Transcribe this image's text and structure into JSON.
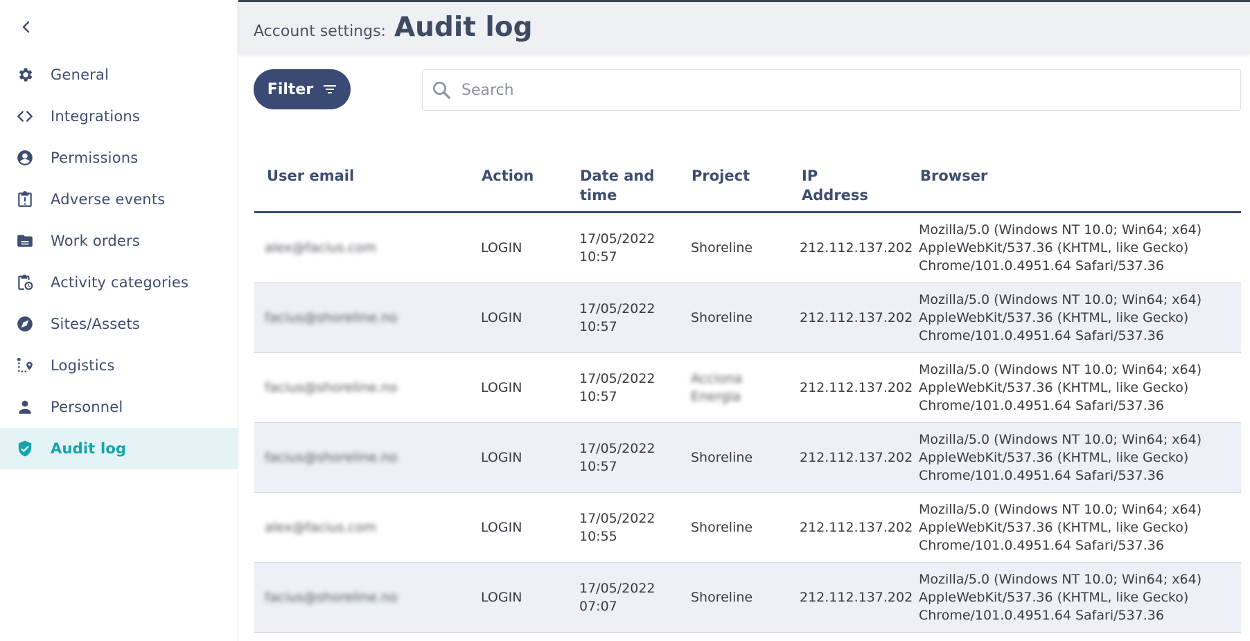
{
  "header": {
    "breadcrumb": "Account settings:",
    "title": "Audit log"
  },
  "sidebar": {
    "items": [
      {
        "label": "General",
        "icon": "gear-icon"
      },
      {
        "label": "Integrations",
        "icon": "code-icon"
      },
      {
        "label": "Permissions",
        "icon": "user-circle-icon"
      },
      {
        "label": "Adverse events",
        "icon": "clipboard-alert-icon"
      },
      {
        "label": "Work orders",
        "icon": "folder-icon"
      },
      {
        "label": "Activity categories",
        "icon": "clipboard-clock-icon"
      },
      {
        "label": "Sites/Assets",
        "icon": "compass-icon"
      },
      {
        "label": "Logistics",
        "icon": "route-pin-icon"
      },
      {
        "label": "Personnel",
        "icon": "person-icon"
      },
      {
        "label": "Audit log",
        "icon": "shield-check-icon",
        "active": true
      }
    ]
  },
  "toolbar": {
    "filter_label": "Filter",
    "search_placeholder": "Search"
  },
  "table": {
    "columns": [
      "User email",
      "Action",
      "Date and time",
      "Project",
      "IP Address",
      "Browser"
    ],
    "rows": [
      {
        "email": "alex@facius.com",
        "action": "LOGIN",
        "date": "17/05/2022",
        "time": "10:57",
        "project": "Shoreline",
        "ip": "212.112.137.202",
        "browser1": "Mozilla/5.0 (Windows NT 10.0; Win64; x64)",
        "browser2": "AppleWebKit/537.36 (KHTML, like Gecko)",
        "browser3": "Chrome/101.0.4951.64 Safari/537.36"
      },
      {
        "email": "facius@shoreline.no",
        "action": "LOGIN",
        "date": "17/05/2022",
        "time": "10:57",
        "project": "Shoreline",
        "ip": "212.112.137.202",
        "browser1": "Mozilla/5.0 (Windows NT 10.0; Win64; x64)",
        "browser2": "AppleWebKit/537.36 (KHTML, like Gecko)",
        "browser3": "Chrome/101.0.4951.64 Safari/537.36"
      },
      {
        "email": "facius@shoreline.no",
        "action": "LOGIN",
        "date": "17/05/2022",
        "time": "10:57",
        "project": "Acciona Energia",
        "ip": "212.112.137.202",
        "browser1": "Mozilla/5.0 (Windows NT 10.0; Win64; x64)",
        "browser2": "AppleWebKit/537.36 (KHTML, like Gecko)",
        "browser3": "Chrome/101.0.4951.64 Safari/537.36"
      },
      {
        "email": "facius@shoreline.no",
        "action": "LOGIN",
        "date": "17/05/2022",
        "time": "10:57",
        "project": "Shoreline",
        "ip": "212.112.137.202",
        "browser1": "Mozilla/5.0 (Windows NT 10.0; Win64; x64)",
        "browser2": "AppleWebKit/537.36 (KHTML, like Gecko)",
        "browser3": "Chrome/101.0.4951.64 Safari/537.36"
      },
      {
        "email": "alex@facius.com",
        "action": "LOGIN",
        "date": "17/05/2022",
        "time": "10:55",
        "project": "Shoreline",
        "ip": "212.112.137.202",
        "browser1": "Mozilla/5.0 (Windows NT 10.0; Win64; x64)",
        "browser2": "AppleWebKit/537.36 (KHTML, like Gecko)",
        "browser3": "Chrome/101.0.4951.64 Safari/537.36"
      },
      {
        "email": "facius@shoreline.no",
        "action": "LOGIN",
        "date": "17/05/2022",
        "time": "07:07",
        "project": "Shoreline",
        "ip": "212.112.137.202",
        "browser1": "Mozilla/5.0 (Windows NT 10.0; Win64; x64)",
        "browser2": "AppleWebKit/537.36 (KHTML, like Gecko)",
        "browser3": "Chrome/101.0.4951.64 Safari/537.36"
      }
    ]
  },
  "colors": {
    "primary": "#3a4a74",
    "accent": "#15a4ae",
    "active_bg": "#e3f3f6",
    "row_alt": "#edf0f7"
  }
}
